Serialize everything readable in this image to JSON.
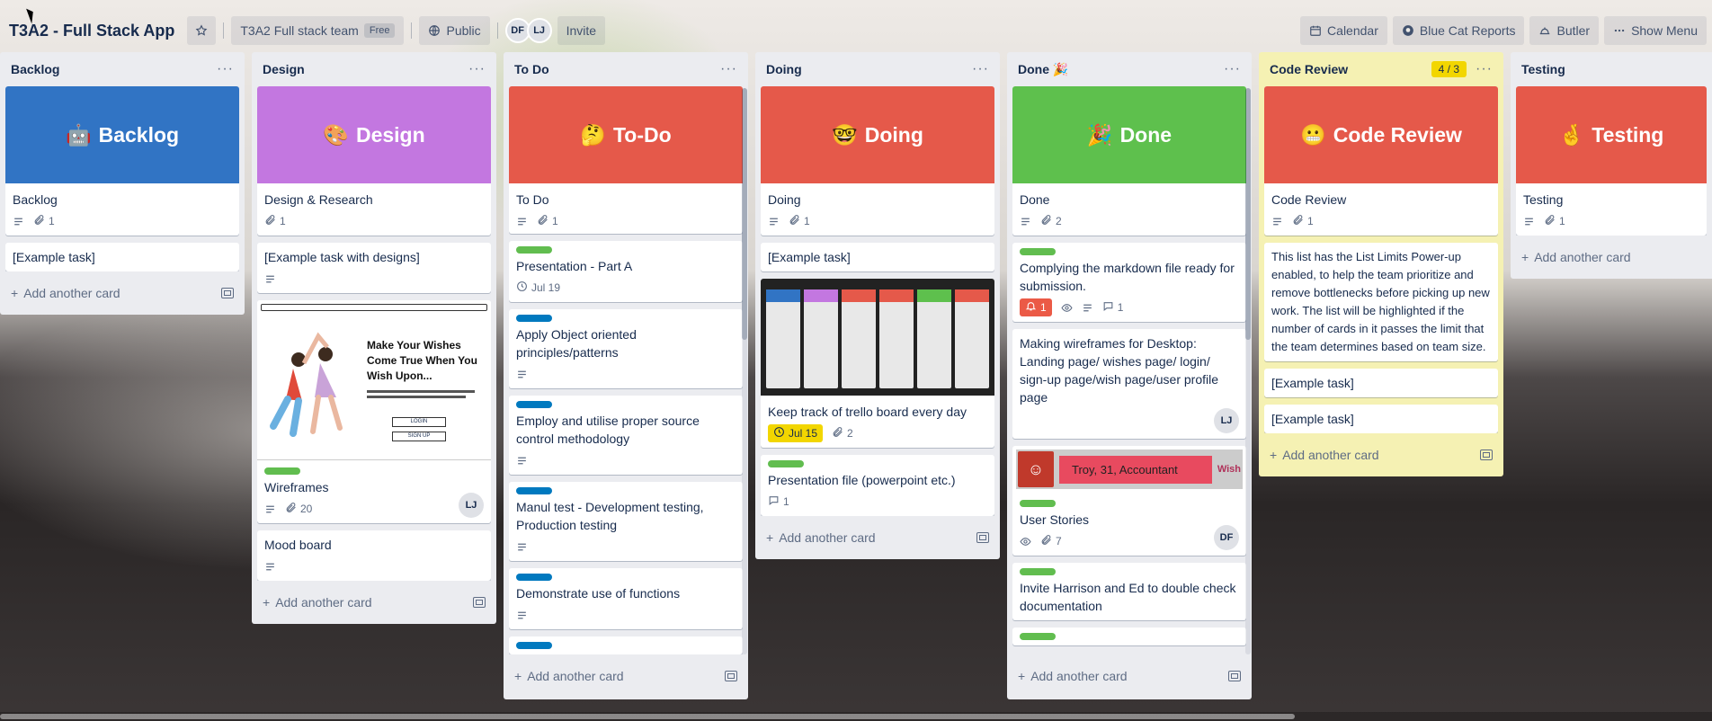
{
  "topbar": {
    "board_title": "T3A2 - Full Stack App",
    "team_name": "T3A2 Full stack team",
    "team_plan": "Free",
    "visibility": "Public",
    "members": [
      "DF",
      "LJ"
    ],
    "invite_label": "Invite",
    "calendar_label": "Calendar",
    "bluecat_label": "Blue Cat Reports",
    "butler_label": "Butler",
    "show_menu_label": "Show Menu"
  },
  "add_card_label": "Add another card",
  "lists": {
    "backlog": {
      "title": "Backlog",
      "cover": {
        "emoji": "�with",
        "text": "Backlog",
        "color": "#3174c4"
      },
      "cover_card": {
        "title": "Backlog",
        "attachments": "1"
      },
      "cards": [
        {
          "title": "[Example task]"
        }
      ]
    },
    "design": {
      "title": "Design",
      "cover": {
        "emoji": "🎨",
        "text": "Design",
        "color": "#c377e0"
      },
      "cover_card": {
        "title": "Design & Research",
        "attachments": "1"
      },
      "cards": [
        {
          "title": "[Example task with designs]"
        },
        {
          "title": "Wireframes",
          "attachments": "20",
          "member": "LJ",
          "image_text": "Make Your Wishes Come True When You Wish Upon...",
          "image_buttons": [
            "LOGIN",
            "SIGN UP"
          ]
        },
        {
          "title": "Mood board"
        }
      ]
    },
    "todo": {
      "title": "To Do",
      "cover": {
        "emoji": "🤔",
        "text": "To-Do",
        "color": "#e5594a"
      },
      "cover_card": {
        "title": "To Do",
        "attachments": "1"
      },
      "cards": [
        {
          "title": "Presentation - Part A",
          "due": "Jul 19"
        },
        {
          "title": "Apply Object oriented principles/patterns"
        },
        {
          "title": "Employ and utilise proper source control methodology"
        },
        {
          "title": "Manul test - Development testing, Production testing"
        },
        {
          "title": "Demonstrate use of functions"
        }
      ]
    },
    "doing": {
      "title": "Doing",
      "cover": {
        "emoji": "🤓",
        "text": "Doing",
        "color": "#e5594a"
      },
      "cover_card": {
        "title": "Doing",
        "attachments": "1"
      },
      "cards": [
        {
          "title": "[Example task]"
        },
        {
          "title": "Keep track of trello board every day",
          "due": "Jul 15",
          "attachments": "2"
        },
        {
          "title": "Presentation file (powerpoint etc.)",
          "comments": "1"
        }
      ]
    },
    "done": {
      "title": "Done 🎉",
      "cover": {
        "emoji": "🎉",
        "text": "Done",
        "color": "#5ec04d"
      },
      "cover_card": {
        "title": "Done",
        "attachments": "2"
      },
      "cards": [
        {
          "title": "Complying the markdown file ready for submission.",
          "notifications": "1",
          "comments": "1"
        },
        {
          "title": "Making wireframes for Desktop: Landing page/ wishes page/ login/ sign-up page/wish page/user profile page",
          "member": "LJ"
        },
        {
          "title": "User Stories",
          "attachments": "7",
          "member": "DF",
          "banner_text": "Troy, 31, Accountant",
          "banner_logo": "Wish"
        },
        {
          "title": "Invite Harrison and Ed to double check documentation"
        }
      ]
    },
    "code_review": {
      "title": "Code Review",
      "limit": "4 / 3",
      "cover": {
        "emoji": "😬",
        "text": "Code Review",
        "color": "#e5594a"
      },
      "cover_card": {
        "title": "Code Review",
        "attachments": "1"
      },
      "cards": [
        {
          "title": "This list has the List Limits Power-up enabled, to help the team prioritize and remove bottlenecks before picking up new work. The list will be highlighted if the number of cards in it passes the limit that the team determines based on team size."
        },
        {
          "title": "[Example task]"
        },
        {
          "title": "[Example task]"
        }
      ]
    },
    "testing": {
      "title": "Testing",
      "cover": {
        "emoji": "🤞",
        "text": "Testing",
        "color": "#e5594a"
      },
      "cover_card": {
        "title": "Testing",
        "attachments": "1"
      }
    }
  }
}
